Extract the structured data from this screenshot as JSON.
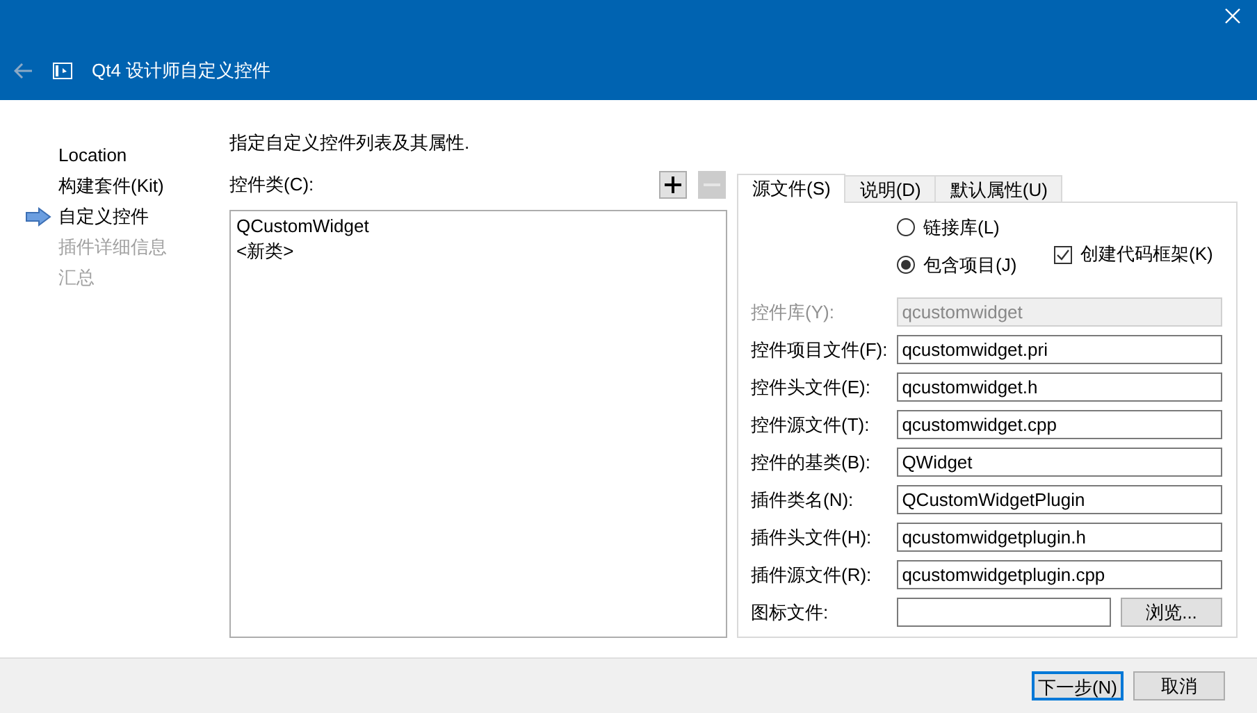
{
  "window": {
    "title": "Qt4 设计师自定义控件"
  },
  "steps": [
    {
      "label": "Location",
      "current": false,
      "disabled": false
    },
    {
      "label": "构建套件(Kit)",
      "current": false,
      "disabled": false
    },
    {
      "label": "自定义控件",
      "current": true,
      "disabled": false
    },
    {
      "label": "插件详细信息",
      "current": false,
      "disabled": true
    },
    {
      "label": "汇总",
      "current": false,
      "disabled": true
    }
  ],
  "description": "指定自定义控件列表及其属性.",
  "class_list": {
    "label": "控件类(C):",
    "buttons": [
      {
        "kind": "add",
        "disabled": false
      },
      {
        "kind": "remove",
        "disabled": true
      }
    ],
    "items": [
      "QCustomWidget",
      "<新类>"
    ]
  },
  "tabs": [
    {
      "label": "源文件(S)",
      "selected": true
    },
    {
      "label": "说明(D)",
      "selected": false
    },
    {
      "label": "默认属性(U)",
      "selected": false
    }
  ],
  "radios": [
    {
      "label": "链接库(L)",
      "selected": false
    },
    {
      "label": "包含项目(J)",
      "selected": true
    }
  ],
  "checkbox": {
    "label": "创建代码框架(K)",
    "checked": true
  },
  "fields": [
    {
      "label": "控件库(Y):",
      "value": "qcustomwidget",
      "disabled": true
    },
    {
      "label": "控件项目文件(F):",
      "value": "qcustomwidget.pri",
      "disabled": false
    },
    {
      "label": "控件头文件(E):",
      "value": "qcustomwidget.h",
      "disabled": false
    },
    {
      "label": "控件源文件(T):",
      "value": "qcustomwidget.cpp",
      "disabled": false
    },
    {
      "label": "控件的基类(B):",
      "value": "QWidget",
      "disabled": false
    },
    {
      "label": "插件类名(N):",
      "value": "QCustomWidgetPlugin",
      "disabled": false
    },
    {
      "label": "插件头文件(H):",
      "value": "qcustomwidgetplugin.h",
      "disabled": false
    },
    {
      "label": "插件源文件(R):",
      "value": "qcustomwidgetplugin.cpp",
      "disabled": false
    },
    {
      "label": "图标文件:",
      "disabled": false,
      "button": "浏览..."
    }
  ],
  "footer": [
    {
      "label": "下一步(N)",
      "focused": true
    },
    {
      "label": "取消",
      "focused": false
    }
  ]
}
